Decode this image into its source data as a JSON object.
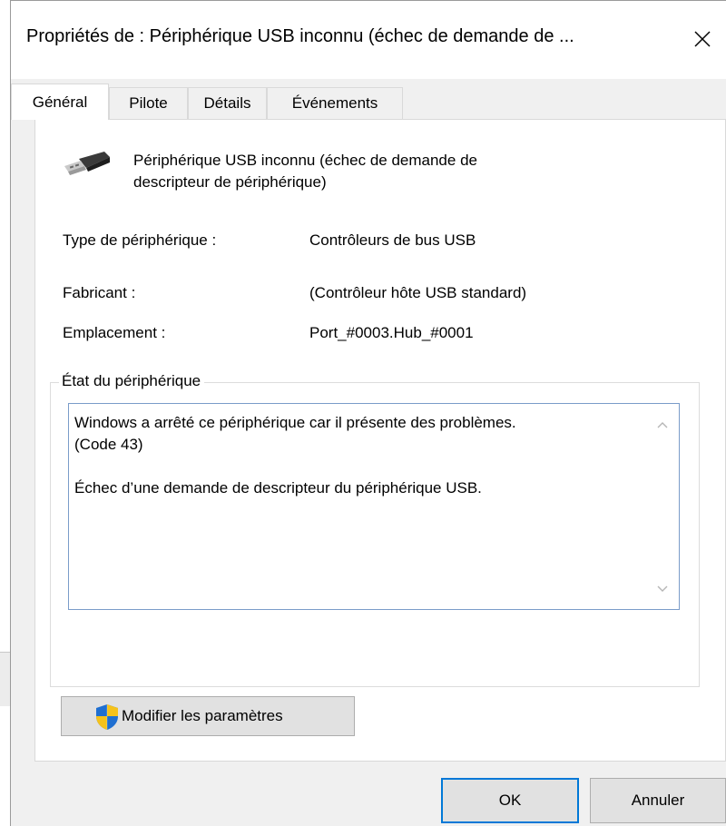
{
  "window": {
    "title": "Propriétés de : Périphérique USB inconnu (échec de demande de ..."
  },
  "tabs": [
    {
      "label": "Général"
    },
    {
      "label": "Pilote"
    },
    {
      "label": "Détails"
    },
    {
      "label": "Événements"
    }
  ],
  "general": {
    "device_name": "Périphérique USB inconnu (échec de demande de\ndescripteur de périphérique)",
    "properties": [
      {
        "label": "Type de périphérique :",
        "value": "Contrôleurs de bus USB"
      },
      {
        "label": "Fabricant :",
        "value": "(Contrôleur hôte USB standard)"
      },
      {
        "label": "Emplacement :",
        "value": "Port_#0003.Hub_#0001"
      }
    ],
    "status_group_label": "État du périphérique",
    "status_text": "Windows a arrêté ce périphérique car il présente des problèmes.\n(Code 43)\n\nÉchec d’une demande de descripteur du périphérique USB.",
    "change_settings_label": "Modifier les paramètres"
  },
  "buttons": {
    "ok": "OK",
    "cancel": "Annuler"
  },
  "colors": {
    "accent": "#0078d7",
    "shield_blue": "#1f6fd1",
    "shield_yellow": "#f5c21b"
  },
  "icons": {
    "device": "usb-plug-icon",
    "close": "close-icon",
    "shield": "uac-shield-icon"
  }
}
